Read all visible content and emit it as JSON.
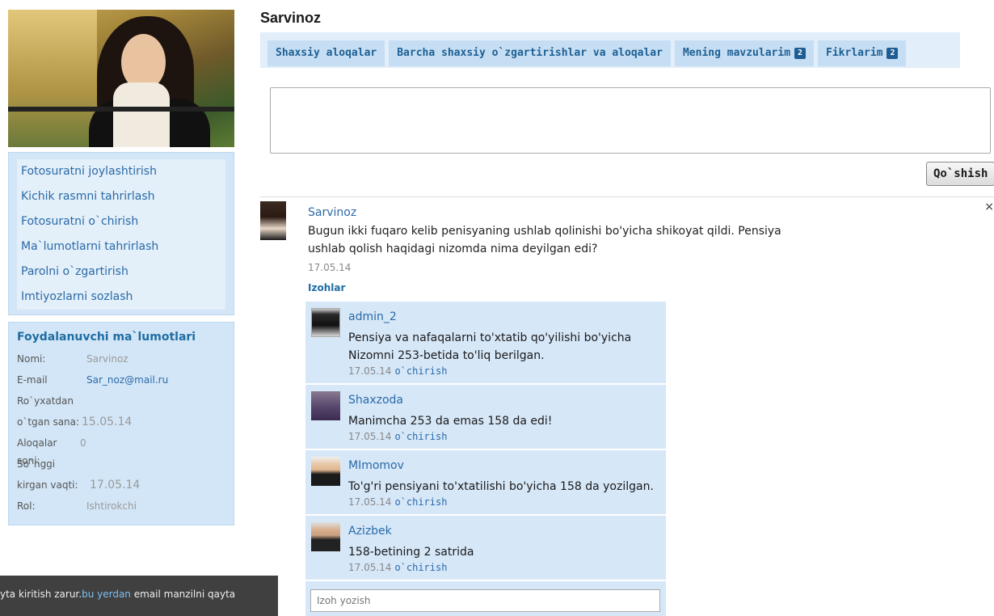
{
  "sidebar": {
    "menu": [
      "Fotosuratni joylashtirish",
      "Kichik rasmni tahrirlash",
      "Fotosuratni o`chirish",
      "Ma`lumotlarni tahrirlash",
      "Parolni o`zgartirish",
      "Imtiyozlarni sozlash"
    ],
    "info": {
      "title": "Foydalanuvchi ma`lumotlari",
      "name_label": "Nomi:",
      "name_value": "Sarvinoz",
      "email_label": "E-mail",
      "email_value": "Sar_noz@mail.ru",
      "registered_label_1": "Ro`yxatdan",
      "registered_label_2": "o`tgan sana:",
      "registered_value": "15.05.14",
      "contacts_label": "Aloqalar soni:",
      "contacts_value": "0",
      "last_label_1": "So`nggi",
      "last_label_2": "kirgan vaqti:",
      "last_value": "17.05.14",
      "role_label": "Rol:",
      "role_value": "Ishtirokchi"
    }
  },
  "main": {
    "title": "Sarvinoz",
    "tabs": [
      {
        "label": "Shaxsiy aloqalar",
        "badge": ""
      },
      {
        "label": "Barcha shaxsiy o`zgartirishlar va aloqalar",
        "badge": ""
      },
      {
        "label": "Mening mavzularim",
        "badge": "2"
      },
      {
        "label": "Fikrlarim",
        "badge": "2"
      }
    ],
    "add_button": "Qo`shish",
    "close_symbol": "×",
    "post": {
      "author": "Sarvinoz",
      "text": "Bugun ikki fuqaro kelib penisyaning ushlab qolinishi bo'yicha shikoyat qildi. Pensiya ushlab qolish haqidagi nizomda nima deyilgan edi?",
      "date": "17.05.14",
      "comments_heading": "Izohlar"
    },
    "comments": [
      {
        "author": "admin_2",
        "text": "Pensiya va nafaqalarni to'xtatib qo'yilishi bo'yicha Nizomni 253-betida to'liq berilgan.",
        "date": "17.05.14",
        "delete": "o`chirish"
      },
      {
        "author": "Shaxzoda",
        "text": "Manimcha 253 da emas 158 da edi!",
        "date": "17.05.14",
        "delete": "o`chirish"
      },
      {
        "author": "MImomov",
        "text": "To'g'ri pensiyani to'xtatilishi bo'yicha 158 da yozilgan.",
        "date": "17.05.14",
        "delete": "o`chirish"
      },
      {
        "author": "Azizbek",
        "text": "158-betining 2 satrida",
        "date": "17.05.14",
        "delete": "o`chirish"
      }
    ],
    "reply_placeholder": "Izoh yozish"
  },
  "notice": {
    "before": "yta kiritish zarur.",
    "link": "bu yerdan",
    "after": " email manzilni qayta"
  }
}
